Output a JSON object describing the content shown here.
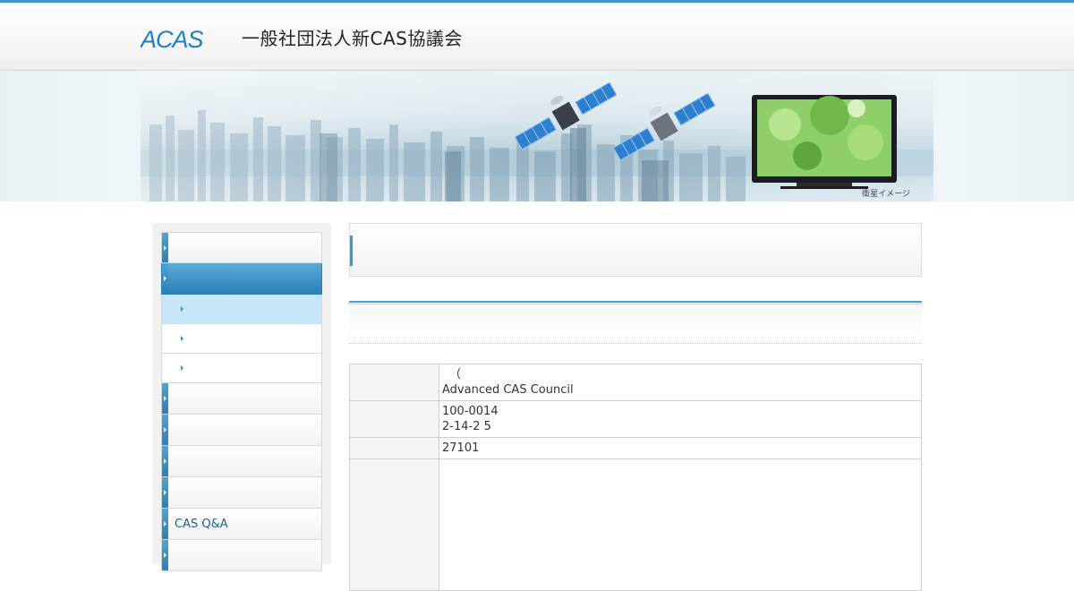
{
  "header": {
    "logo_text": "ACAS",
    "org_name": "一般社団法人新CAS協議会"
  },
  "banner": {
    "caption": "衛星イメージ"
  },
  "sidebar": {
    "items": [
      {
        "label": ""
      },
      {
        "label": ""
      },
      {
        "label": ""
      },
      {
        "label": ""
      },
      {
        "label": ""
      },
      {
        "label": ""
      },
      {
        "label": ""
      },
      {
        "label": ""
      },
      {
        "label": ""
      },
      {
        "label": "CAS Q&A"
      },
      {
        "label": ""
      }
    ]
  },
  "main": {
    "title": "",
    "section_title": "",
    "table": [
      {
        "header": "",
        "lines": [
          "（",
          "Advanced CAS Council"
        ]
      },
      {
        "header": "",
        "lines": [
          "100-0014",
          "2-14-2 5"
        ]
      },
      {
        "header": "",
        "lines": [
          "27101"
        ]
      },
      {
        "header": "",
        "lines": [
          ""
        ]
      }
    ]
  },
  "colors": {
    "accent": "#3d97cb",
    "nav_active": "#2d7fb8",
    "nav_current_sub": "#c8e6fa"
  }
}
